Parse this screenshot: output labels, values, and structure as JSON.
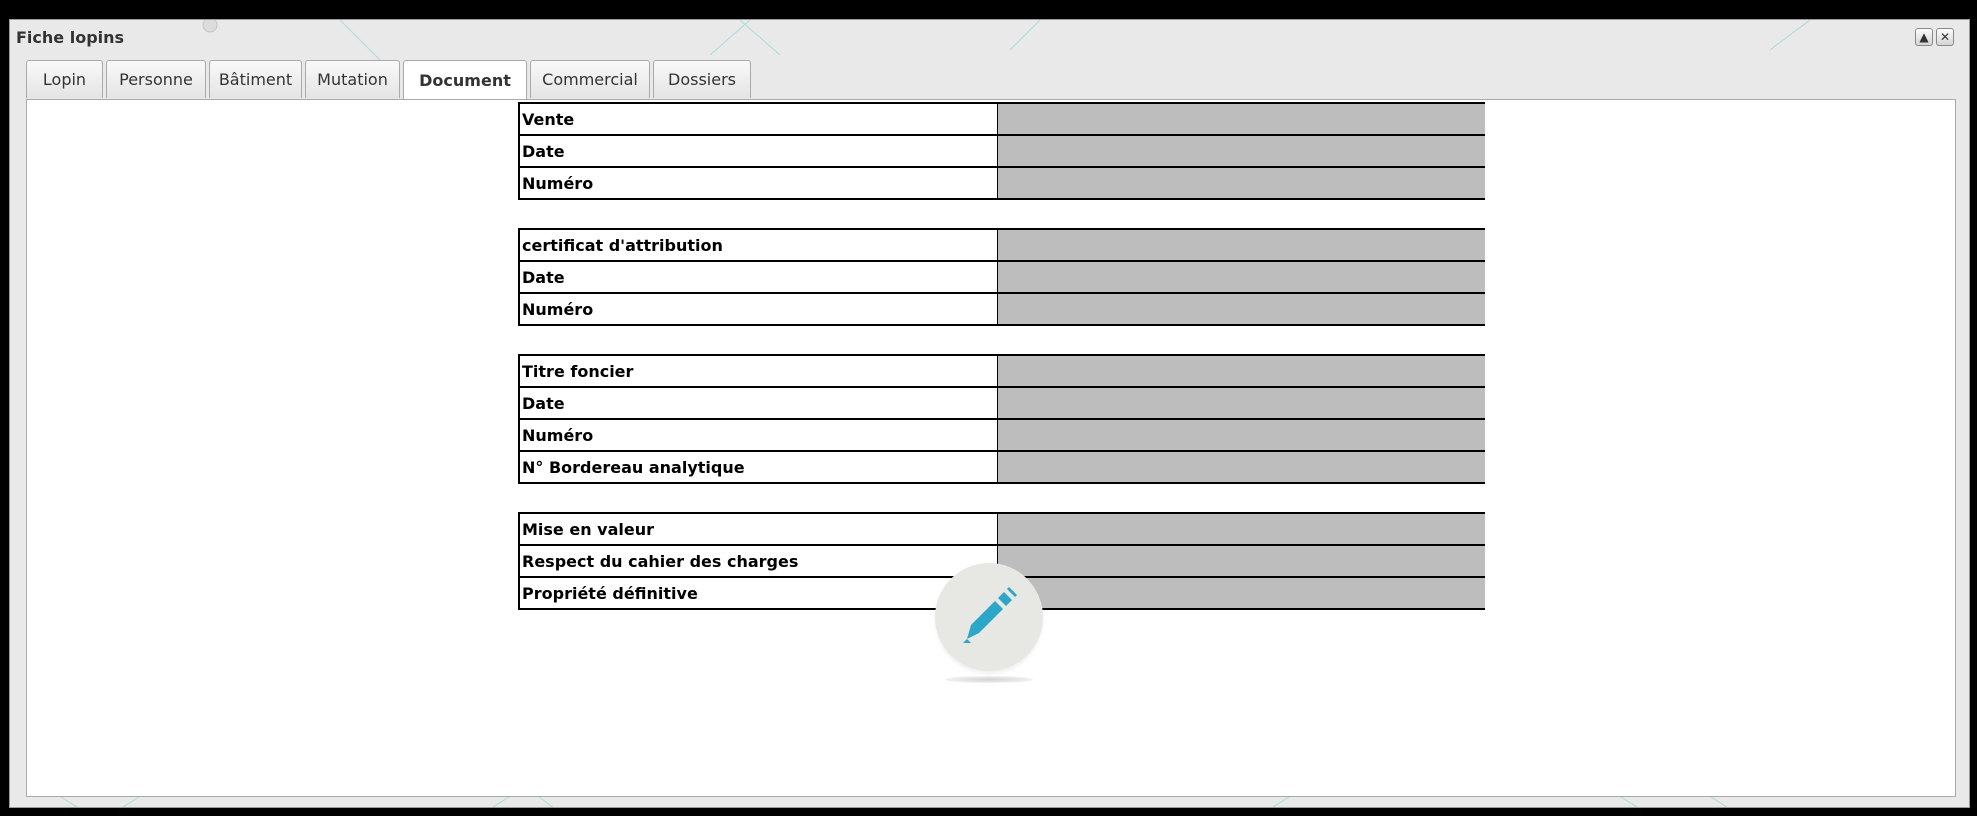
{
  "window": {
    "title": "Fiche lopins",
    "collapse_icon": "collapse-up-icon",
    "close_icon": "close-icon"
  },
  "tabs": [
    {
      "label": "Lopin",
      "active": false
    },
    {
      "label": "Personne",
      "active": false
    },
    {
      "label": "Bâtiment",
      "active": false
    },
    {
      "label": "Mutation",
      "active": false
    },
    {
      "label": "Document",
      "active": true
    },
    {
      "label": "Commercial",
      "active": false
    },
    {
      "label": "Dossiers",
      "active": false
    }
  ],
  "form": {
    "groups": [
      {
        "rows": [
          {
            "label": "Vente",
            "value": ""
          },
          {
            "label": "Date",
            "value": ""
          },
          {
            "label": "Numéro",
            "value": ""
          }
        ]
      },
      {
        "rows": [
          {
            "label": "certificat d'attribution",
            "value": ""
          },
          {
            "label": "Date",
            "value": ""
          },
          {
            "label": "Numéro",
            "value": ""
          }
        ]
      },
      {
        "rows": [
          {
            "label": "Titre foncier",
            "value": ""
          },
          {
            "label": "Date",
            "value": ""
          },
          {
            "label": "Numéro",
            "value": ""
          },
          {
            "label": "N° Bordereau analytique",
            "value": ""
          }
        ]
      },
      {
        "rows": [
          {
            "label": "Mise en valeur",
            "value": ""
          },
          {
            "label": "Respect du cahier des charges",
            "value": ""
          },
          {
            "label": "Propriété définitive",
            "value": ""
          }
        ]
      }
    ]
  },
  "edit_button": {
    "icon": "pencil-icon"
  },
  "colors": {
    "value_cell": "#bdbdbd",
    "pencil": "#2aa7c9",
    "edit_circle": "#e7e7e3"
  }
}
